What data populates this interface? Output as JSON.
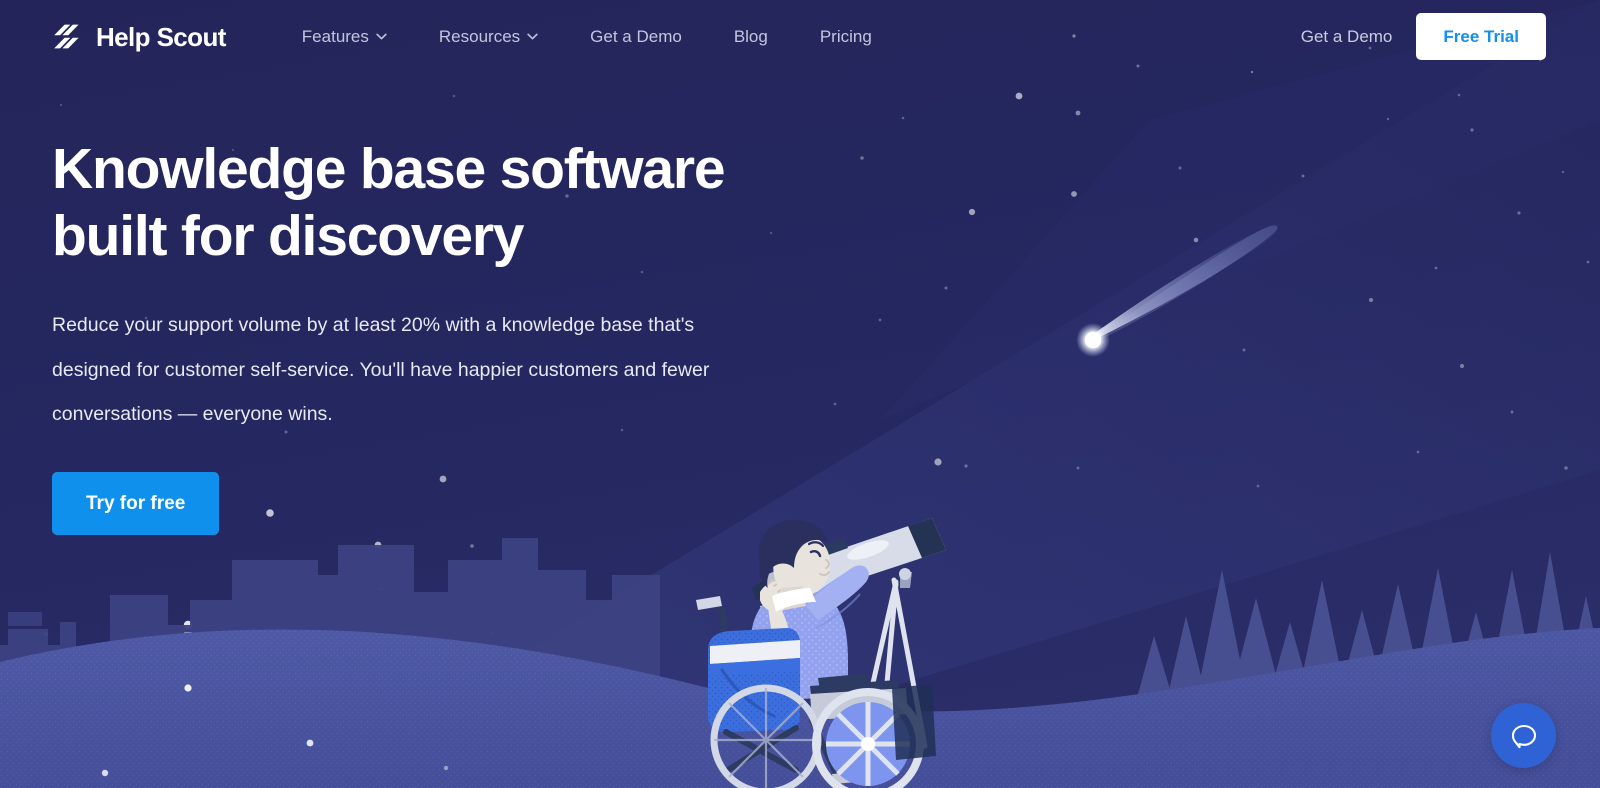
{
  "brand": {
    "name": "Help Scout",
    "logo_icon": "help-scout-logo-icon"
  },
  "nav": {
    "items": [
      {
        "label": "Features",
        "has_dropdown": true,
        "icon": "chevron-down-icon"
      },
      {
        "label": "Resources",
        "has_dropdown": true,
        "icon": "chevron-down-icon"
      },
      {
        "label": "Get a Demo",
        "has_dropdown": false,
        "icon": ""
      },
      {
        "label": "Blog",
        "has_dropdown": false,
        "icon": ""
      },
      {
        "label": "Pricing",
        "has_dropdown": false,
        "icon": ""
      }
    ],
    "demo_link": "Get a Demo",
    "trial_button": "Free Trial"
  },
  "hero": {
    "title_line1": "Knowledge base software",
    "title_line2": "built for discovery",
    "subtitle": "Reduce your support volume by at least 20% with a knowledge base that's designed for customer self-service. You'll have happier customers and fewer conversations — everyone wins.",
    "cta_label": "Try for free"
  },
  "illustration": {
    "name": "astronomer-in-wheelchair-with-telescope",
    "scene_elements": [
      "night-sky",
      "stars",
      "comet",
      "city-skyline",
      "pine-trees",
      "hill"
    ]
  },
  "chat": {
    "icon": "chat-bubble-icon",
    "label": "Open chat"
  },
  "colors": {
    "background_navy": "#25275C",
    "sky_deep": "#1F2152",
    "ground_blue": "#4A55A0",
    "skyline_purple": "#3C4182",
    "tree_purple": "#474E91",
    "accent_blue": "#0F90EC",
    "trial_text_blue": "#1290ED",
    "chat_blue": "#2F62D4",
    "nav_text": "#C3C6DE",
    "white": "#FFFFFF"
  }
}
